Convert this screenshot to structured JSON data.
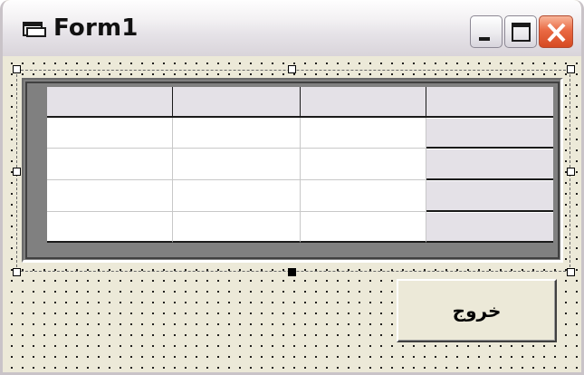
{
  "window": {
    "title": "Form1",
    "icon": "form-window-icon",
    "controls": [
      "minimize-icon",
      "maximize-icon",
      "close-icon"
    ],
    "close_color": "#e0582e"
  },
  "grid": {
    "columns": 4,
    "rows": 5,
    "fixed_header_rows": 1,
    "fixed_right_column": true,
    "cells": [
      [
        "",
        "",
        "",
        ""
      ],
      [
        "",
        "",
        "",
        ""
      ],
      [
        "",
        "",
        "",
        ""
      ],
      [
        "",
        "",
        "",
        ""
      ],
      [
        "",
        "",
        "",
        ""
      ]
    ]
  },
  "exit_button": {
    "label": "خروج"
  },
  "designer": {
    "grid_dots": true,
    "control_selected": true
  }
}
